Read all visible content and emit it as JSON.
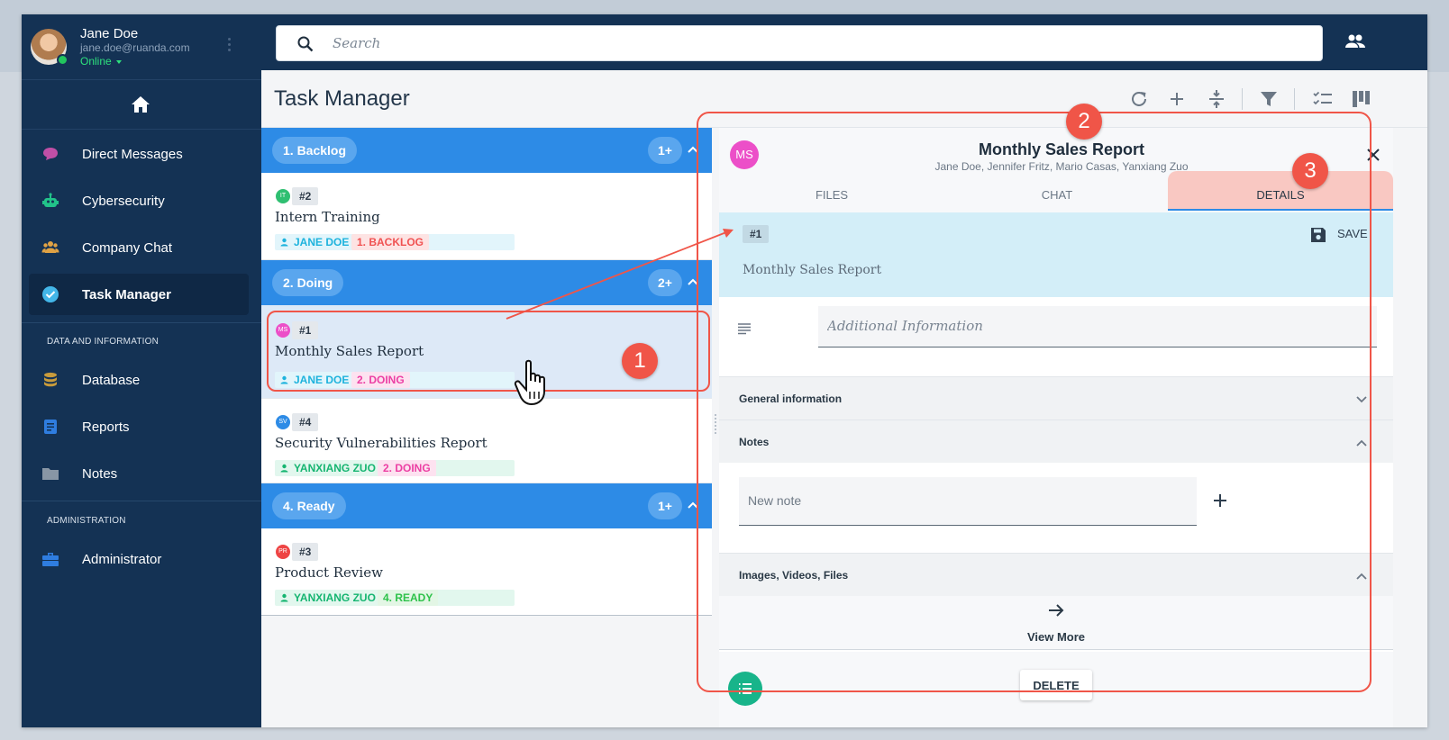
{
  "user": {
    "name": "Jane Doe",
    "email": "jane.doe@ruanda.com",
    "status": "Online"
  },
  "sidebar": {
    "home_icon": "home-icon",
    "items": [
      {
        "label": "Direct Messages",
        "icon": "chat-bubble-icon",
        "color": "#c04fa6"
      },
      {
        "label": "Cybersecurity",
        "icon": "robot-icon",
        "color": "#22c38a"
      },
      {
        "label": "Company Chat",
        "icon": "group-icon",
        "color": "#e0a244"
      },
      {
        "label": "Task Manager",
        "icon": "check-circle-icon",
        "color": "#43b6e8",
        "active": true
      }
    ],
    "section_data": "DATA AND INFORMATION",
    "data_items": [
      {
        "label": "Database",
        "icon": "database-icon",
        "color": "#c89b3c"
      },
      {
        "label": "Reports",
        "icon": "document-icon",
        "color": "#2f7de0"
      },
      {
        "label": "Notes",
        "icon": "folder-icon",
        "color": "#8896a5"
      }
    ],
    "section_admin": "ADMINISTRATION",
    "admin_items": [
      {
        "label": "Administrator",
        "icon": "toolbox-icon",
        "color": "#2f7de0"
      }
    ]
  },
  "search": {
    "placeholder": "Search"
  },
  "page": {
    "title": "Task Manager"
  },
  "toolbar": [
    "refresh-icon",
    "add-icon",
    "collapse-icon",
    "filter-icon",
    "checklist-icon",
    "kanban-icon"
  ],
  "groups": [
    {
      "name": "1. Backlog",
      "count": "1+"
    },
    {
      "name": "2. Doing",
      "count": "2+"
    },
    {
      "name": "4. Ready",
      "count": "1+"
    }
  ],
  "tasks": [
    {
      "avatar": "IT",
      "avatar_color": "#2fbf71",
      "num": "#2",
      "title": "Intern Training",
      "assignee": "JANE DOE",
      "status": "1. BACKLOG"
    },
    {
      "avatar": "MS",
      "avatar_color": "#ec4fc8",
      "num": "#1",
      "title": "Monthly Sales Report",
      "assignee": "JANE DOE",
      "status": "2. DOING"
    },
    {
      "avatar": "SV",
      "avatar_color": "#2d8be6",
      "num": "#4",
      "title": "Security Vulnerabilities Report",
      "assignee": "YANXIANG ZUO",
      "status": "2. DOING"
    },
    {
      "avatar": "PR",
      "avatar_color": "#ee4444",
      "num": "#3",
      "title": "Product Review",
      "assignee": "YANXIANG ZUO",
      "status": "4. READY"
    }
  ],
  "detail": {
    "avatar": "MS",
    "title": "Monthly Sales Report",
    "people": "Jane Doe, Jennifer Fritz, Mario Casas, Yanxiang Zuo",
    "tabs": [
      "FILES",
      "CHAT",
      "DETAILS"
    ],
    "active_tab": "DETAILS",
    "num": "#1",
    "save_label": "SAVE",
    "name_value": "Monthly Sales Report",
    "additional_placeholder": "Additional Information",
    "sections": {
      "general": "General information",
      "notes": "Notes",
      "media": "Images, Videos, Files"
    },
    "new_note_placeholder": "New note",
    "view_more": "View More",
    "delete_label": "DELETE"
  },
  "annotations": [
    "1",
    "2",
    "3"
  ],
  "colors": {
    "sidebar": "#143254",
    "group_header": "#2d8be6",
    "annotation": "#f05548",
    "detail_form": "#d3eef8"
  }
}
